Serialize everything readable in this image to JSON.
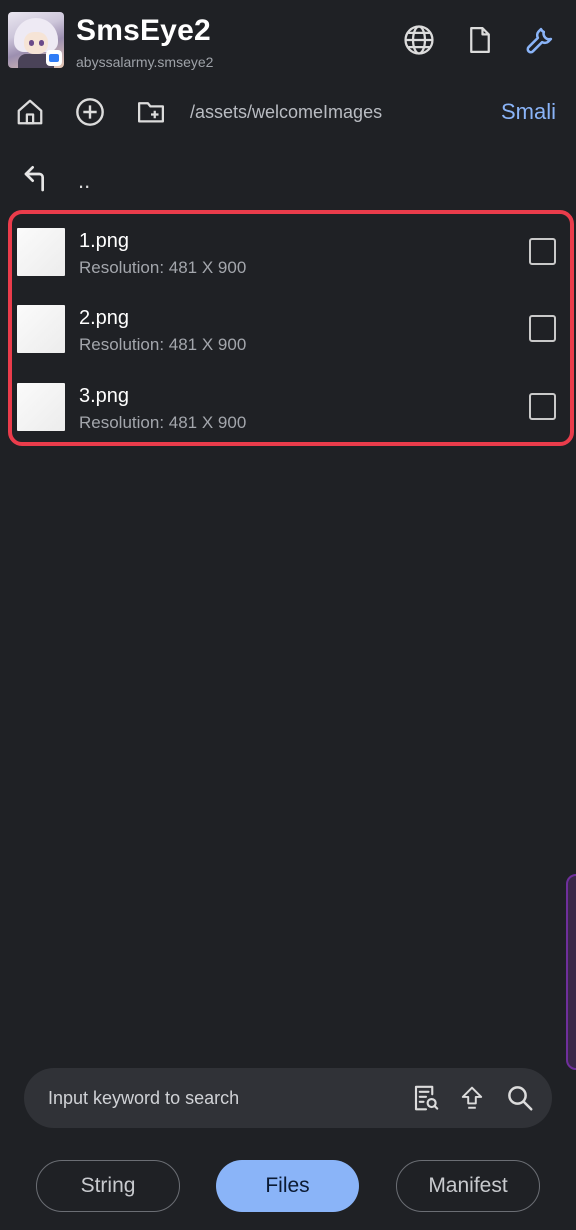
{
  "header": {
    "app_name": "SmsEye2",
    "package_name": "abyssalarmy.smseye2",
    "icons": [
      "globe-icon",
      "document-icon",
      "wrench-icon"
    ]
  },
  "toolbar": {
    "path": "/assets/welcomeImages",
    "smali_label": "Smali",
    "icons": [
      "home-icon",
      "add-circle-icon",
      "new-folder-icon"
    ]
  },
  "parent_dir": {
    "label": ".."
  },
  "files": [
    {
      "name": "1.png",
      "resolution": "Resolution: 481 X 900"
    },
    {
      "name": "2.png",
      "resolution": "Resolution: 481 X 900"
    },
    {
      "name": "3.png",
      "resolution": "Resolution: 481 X 900"
    }
  ],
  "search": {
    "placeholder": "Input keyword to search"
  },
  "tabs": [
    {
      "label": "String",
      "active": false
    },
    {
      "label": "Files",
      "active": true
    },
    {
      "label": "Manifest",
      "active": false
    }
  ],
  "colors": {
    "background": "#1f2125",
    "accent": "#8ab4f8",
    "highlight_border": "#ea3c4b"
  }
}
